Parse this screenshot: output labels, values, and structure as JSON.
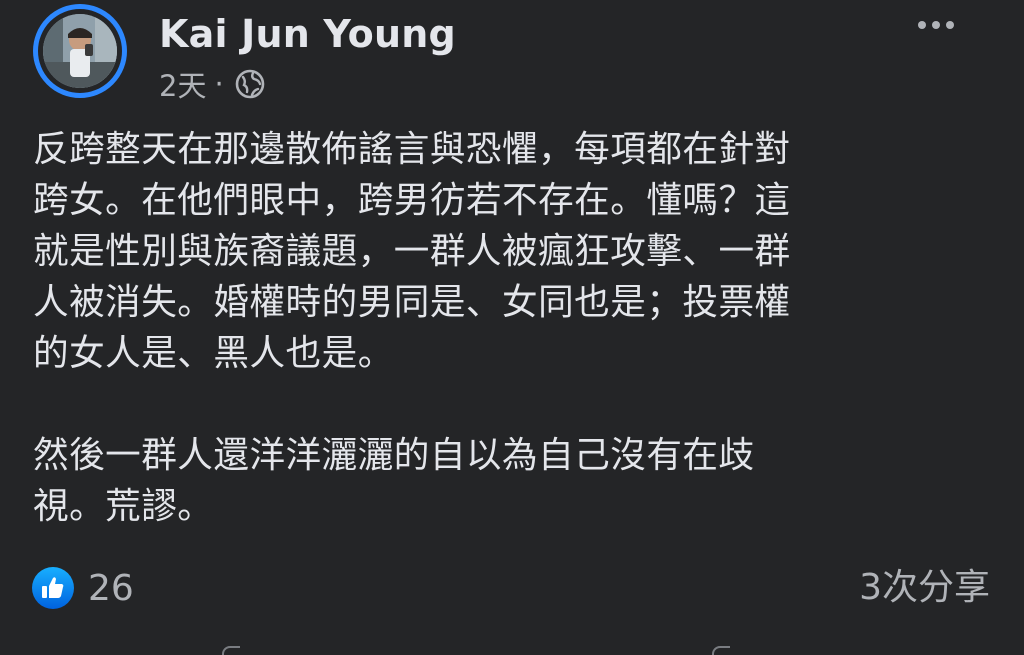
{
  "post": {
    "author": "Kai Jun Young",
    "time": "2天",
    "separator": "·",
    "audience_icon": "globe-icon",
    "more_icon": "more-options-icon",
    "body": "反跨整天在那邊散佈謠言與恐懼，每項都在針對\n跨女。在他們眼中，跨男彷若不存在。懂嗎？這\n就是性別與族裔議題，一群人被瘋狂攻擊、一群\n人被消失。婚權時的男同是、女同也是；投票權\n的女人是、黑人也是。\n\n然後一群人還洋洋灑灑的自以為自己沒有在歧\n視。荒謬。",
    "reactions": {
      "icon": "like-icon",
      "count": "26"
    },
    "shares": "3次分享"
  },
  "colors": {
    "background": "#242527",
    "primary_text": "#e4e6eb",
    "secondary_text": "#b0b3b8",
    "accent_blue": "#2d88ff"
  }
}
